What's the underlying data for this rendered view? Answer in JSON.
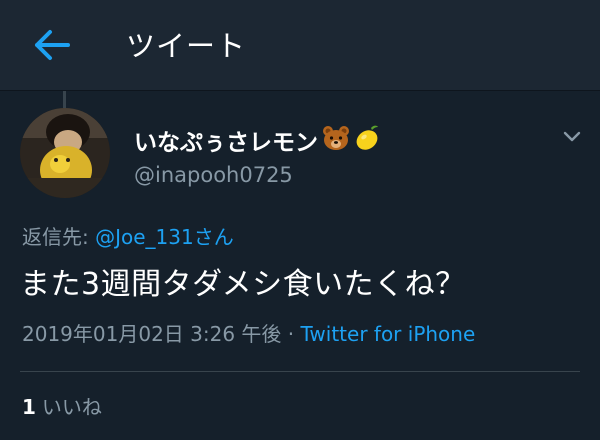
{
  "header": {
    "title": "ツイート",
    "back_icon": "arrow-left-icon",
    "accent_color": "#1da1f2"
  },
  "tweet": {
    "display_name": "いなぷぅさレモン",
    "name_emojis": [
      "bear-face-icon",
      "lemon-icon"
    ],
    "handle": "@inapooh0725",
    "reply_prefix": "返信先: ",
    "reply_mention": "@Joe_131",
    "reply_suffix": "さん",
    "text": "また3週間タダメシ食いたくね？",
    "timestamp": "2019年01月02日 3:26 午後",
    "separator": " · ",
    "source": "Twitter for iPhone",
    "like_count": "1",
    "like_label": "いいね",
    "menu_icon": "chevron-down-icon"
  }
}
